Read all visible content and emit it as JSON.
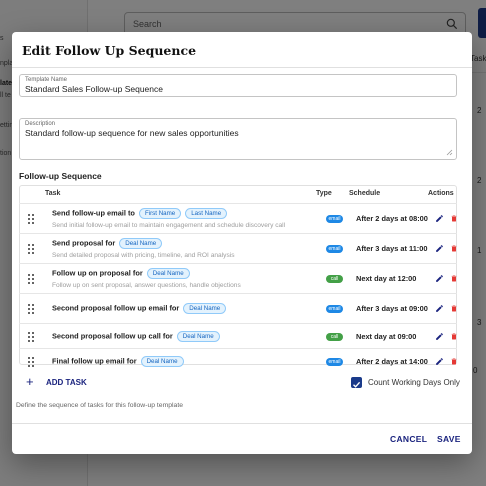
{
  "background": {
    "sidebar_fragments": [
      "s",
      "npla",
      "late",
      "ll te",
      "ettin",
      "tion"
    ],
    "search_placeholder": "Search",
    "column_header": "Tasks",
    "row_counts": [
      "2",
      "2",
      "1",
      "3",
      "0"
    ]
  },
  "dialog": {
    "title": "Edit Follow Up Sequence",
    "template_name": {
      "label": "Template Name",
      "value": "Standard Sales Follow-up Sequence"
    },
    "description": {
      "label": "Description",
      "value": "Standard follow-up sequence for new sales opportunities"
    },
    "section_title": "Follow-up Sequence",
    "columns": {
      "task": "Task",
      "type": "Type",
      "schedule": "Schedule",
      "actions": "Actions"
    },
    "tasks": [
      {
        "title": "Send follow-up email to",
        "chips": [
          "First Name",
          "Last Name"
        ],
        "description": "Send initial follow-up email to maintain engagement and schedule discovery call",
        "type": "email",
        "type_color": "#1e88e5",
        "schedule": "After 2 days at 08:00"
      },
      {
        "title": "Send proposal for",
        "chips": [
          "Deal Name"
        ],
        "description": "Send detailed proposal with pricing, timeline, and ROI analysis",
        "type": "email",
        "type_color": "#1e88e5",
        "schedule": "After 3 days at 11:00"
      },
      {
        "title": "Follow up on proposal for",
        "chips": [
          "Deal Name"
        ],
        "description": "Follow up on sent proposal, answer questions, handle objections",
        "type": "call",
        "type_color": "#43a047",
        "schedule": "Next day at 12:00"
      },
      {
        "title": "Second proposal follow up email for",
        "chips": [
          "Deal Name"
        ],
        "description": "",
        "type": "email",
        "type_color": "#1e88e5",
        "schedule": "After 3 days at 09:00"
      },
      {
        "title": "Second proposal follow up call for",
        "chips": [
          "Deal Name"
        ],
        "description": "",
        "type": "call",
        "type_color": "#43a047",
        "schedule": "Next day at 09:00"
      },
      {
        "title": "Final follow up email for",
        "chips": [
          "Deal Name"
        ],
        "description": "",
        "type": "email",
        "type_color": "#1e88e5",
        "schedule": "After 2 days at 14:00"
      }
    ],
    "add_task_label": "ADD TASK",
    "count_working_days_label": "Count Working Days Only",
    "count_working_days_checked": true,
    "helper_text": "Define the sequence of tasks for this follow-up template",
    "cancel_label": "CANCEL",
    "save_label": "SAVE",
    "colors": {
      "primary": "#1a237e",
      "email_badge": "#1e88e5",
      "call_badge": "#43a047",
      "delete": "#e53935"
    }
  }
}
